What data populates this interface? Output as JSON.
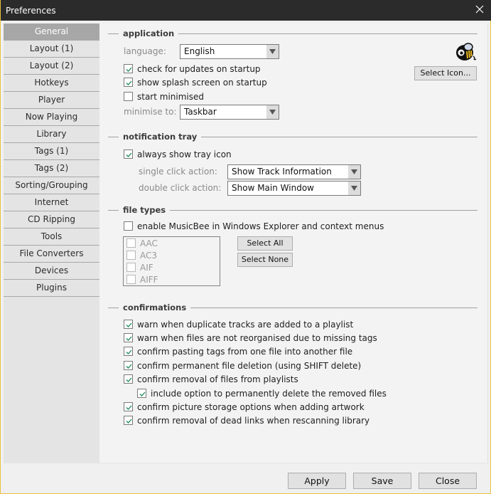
{
  "window": {
    "title": "Preferences"
  },
  "sidebar": {
    "items": [
      {
        "label": "General",
        "active": true
      },
      {
        "label": "Layout (1)"
      },
      {
        "label": "Layout (2)"
      },
      {
        "label": "Hotkeys"
      },
      {
        "label": "Player"
      },
      {
        "label": "Now Playing"
      },
      {
        "label": "Library"
      },
      {
        "label": "Tags (1)"
      },
      {
        "label": "Tags (2)"
      },
      {
        "label": "Sorting/Grouping"
      },
      {
        "label": "Internet"
      },
      {
        "label": "CD Ripping"
      },
      {
        "label": "Tools"
      },
      {
        "label": "File Converters"
      },
      {
        "label": "Devices"
      },
      {
        "label": "Plugins"
      }
    ]
  },
  "application": {
    "heading": "application",
    "language_label": "language:",
    "language_value": "English",
    "check_updates": {
      "label": "check for updates on startup",
      "checked": true
    },
    "show_splash": {
      "label": "show splash screen on startup",
      "checked": true
    },
    "start_minimised": {
      "label": "start minimised",
      "checked": false
    },
    "minimise_to_label": "minimise to:",
    "minimise_to_value": "Taskbar",
    "select_icon_button": "Select Icon..."
  },
  "notification_tray": {
    "heading": "notification tray",
    "always_show": {
      "label": "always show tray icon",
      "checked": true
    },
    "single_click_label": "single click action:",
    "single_click_value": "Show Track Information",
    "double_click_label": "double click action:",
    "double_click_value": "Show Main Window"
  },
  "file_types": {
    "heading": "file types",
    "enable_explorer": {
      "label": "enable MusicBee in Windows Explorer and context menus",
      "checked": false
    },
    "types": [
      {
        "label": "AAC",
        "checked": false
      },
      {
        "label": "AC3",
        "checked": false
      },
      {
        "label": "AIF",
        "checked": false
      },
      {
        "label": "AIFF",
        "checked": false
      }
    ],
    "select_all_button": "Select All",
    "select_none_button": "Select None"
  },
  "confirmations": {
    "heading": "confirmations",
    "items": [
      {
        "label": "warn when duplicate tracks are added to a playlist",
        "checked": true
      },
      {
        "label": "warn when files are not reorganised due to missing tags",
        "checked": true
      },
      {
        "label": "confirm pasting tags from one file into another file",
        "checked": true
      },
      {
        "label": "confirm permanent file deletion (using SHIFT delete)",
        "checked": true
      },
      {
        "label": "confirm removal of files from playlists",
        "checked": true
      },
      {
        "label": "include option to permanently delete the removed files",
        "checked": true,
        "indent": true
      },
      {
        "label": "confirm picture storage options when adding artwork",
        "checked": true
      },
      {
        "label": "confirm removal of dead links when rescanning library",
        "checked": true
      }
    ]
  },
  "footer": {
    "apply_button": "Apply",
    "save_button": "Save",
    "close_button": "Close"
  },
  "colors": {
    "titlebar": "#2b2b2b",
    "window_border": "#e8c23e",
    "active_tab": "#a7a7a7",
    "checkmark": "#1e8a5a"
  }
}
